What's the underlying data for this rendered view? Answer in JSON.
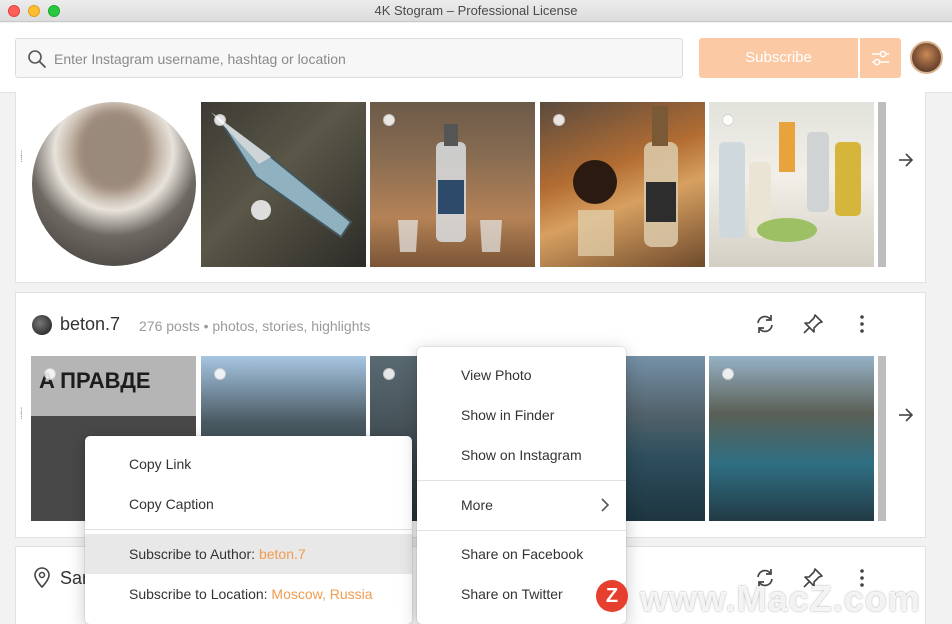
{
  "window": {
    "title": "4K Stogram – Professional License"
  },
  "toolbar": {
    "search_placeholder": "Enter Instagram username, hashtag or location",
    "subscribe_label": "Subscribe",
    "accent": "#fbc9a4"
  },
  "account": {
    "name": "beton.7",
    "meta": "276 posts • photos, stories, highlights"
  },
  "location_card": {
    "name": "Sar"
  },
  "context_menu_left": {
    "copy_link": "Copy Link",
    "copy_caption": "Copy Caption",
    "subscribe_author_prefix": "Subscribe to Author:",
    "subscribe_author_value": "beton.7",
    "subscribe_location_prefix": "Subscribe to Location:",
    "subscribe_location_value": "Moscow, Russia"
  },
  "context_menu_right": {
    "view_photo": "View Photo",
    "show_in_finder": "Show in Finder",
    "show_on_instagram": "Show on Instagram",
    "more": "More",
    "share_facebook": "Share on Facebook",
    "share_twitter": "Share on Twitter"
  },
  "watermark": {
    "badge": "Z",
    "text": "www.MacZ.com"
  },
  "colors": {
    "highlight_value": "#f29b50",
    "menu_hover": "#e8e8e8"
  }
}
